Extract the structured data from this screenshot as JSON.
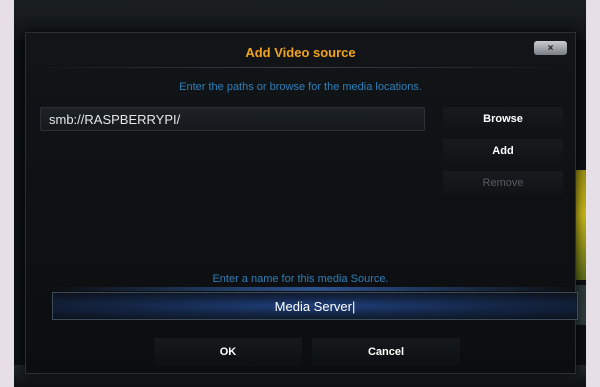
{
  "dialog": {
    "title": "Add Video source",
    "close_label": "×",
    "paths_instruction": "Enter the paths or browse for the media locations.",
    "path_value": "smb://RASPBERRYPI/",
    "browse_label": "Browse",
    "add_label": "Add",
    "remove_label": "Remove",
    "name_instruction": "Enter a name for this media Source.",
    "name_value": "Media Server|",
    "ok_label": "OK",
    "cancel_label": "Cancel"
  },
  "colors": {
    "title": "#f0a41c",
    "instruction": "#2f7fb8",
    "disabled": "#555b60"
  }
}
